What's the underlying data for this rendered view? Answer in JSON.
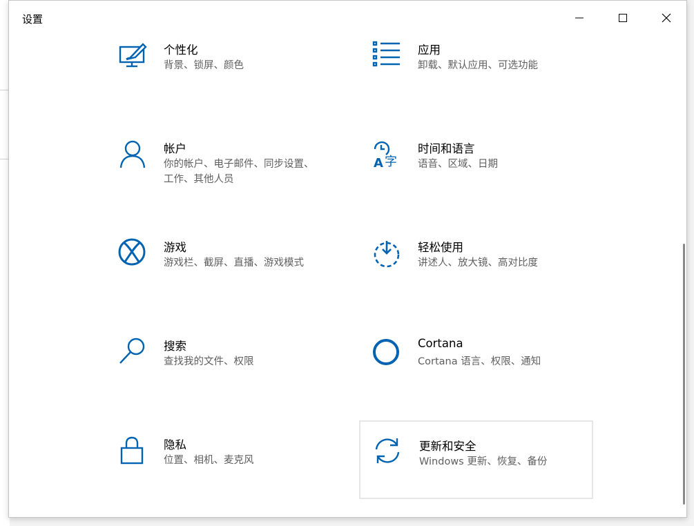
{
  "window": {
    "title": "设置"
  },
  "left_row": [
    {
      "name": "个性化",
      "desc": "背景、锁屏、颜色",
      "icon": "personalization-icon"
    },
    {
      "name": "帐户",
      "desc": "你的帐户、电子邮件、同步设置、工作、其他人员",
      "icon": "accounts-icon"
    },
    {
      "name": "游戏",
      "desc": "游戏栏、截屏、直播、游戏模式",
      "icon": "xbox-icon"
    },
    {
      "name": "搜索",
      "desc": "查找我的文件、权限",
      "icon": "search-icon"
    },
    {
      "name": "隐私",
      "desc": "位置、相机、麦克风",
      "icon": "lock-icon"
    }
  ],
  "right_row": [
    {
      "name": "应用",
      "desc": "卸载、默认应用、可选功能",
      "icon": "apps-list-icon"
    },
    {
      "name": "时间和语言",
      "desc": "语音、区域、日期",
      "icon": "time-language-icon"
    },
    {
      "name": "轻松使用",
      "desc": "讲述人、放大镜、高对比度",
      "icon": "ease-of-access-icon"
    },
    {
      "name": "Cortana",
      "desc": "Cortana 语言、权限、通知",
      "icon": "cortana-icon"
    },
    {
      "name": "更新和安全",
      "desc": "Windows 更新、恢复、备份",
      "icon": "update-sync-icon"
    }
  ],
  "colors": {
    "accent": "#0063b1",
    "text": "#000000",
    "subtext": "#5f5f5f"
  }
}
